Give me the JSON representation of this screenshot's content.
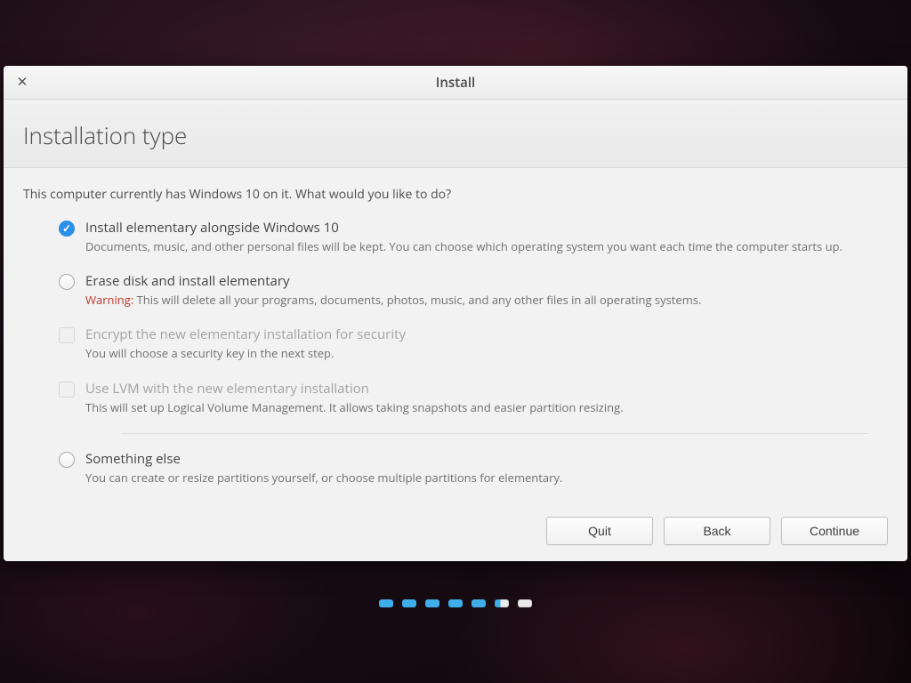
{
  "window": {
    "title": "Install",
    "heading": "Installation type",
    "intro": "This computer currently has Windows 10 on it. What would you like to do?"
  },
  "options": {
    "alongside": {
      "title": "Install elementary alongside Windows 10",
      "desc": "Documents, music, and other personal files will be kept. You can choose which operating system you want each time the computer starts up."
    },
    "erase": {
      "title": "Erase disk and install elementary",
      "warning_label": "Warning:",
      "desc": " This will delete all your programs, documents, photos, music, and any other files in all operating systems."
    },
    "encrypt": {
      "title": "Encrypt the new elementary installation for security",
      "desc": "You will choose a security key in the next step."
    },
    "lvm": {
      "title": "Use LVM with the new elementary installation",
      "desc": "This will set up Logical Volume Management. It allows taking snapshots and easier partition resizing."
    },
    "something_else": {
      "title": "Something else",
      "desc": "You can create or resize partitions yourself, or choose multiple partitions for elementary."
    }
  },
  "buttons": {
    "quit": "Quit",
    "back": "Back",
    "continue": "Continue"
  },
  "progress": {
    "total": 7,
    "current": 5
  }
}
